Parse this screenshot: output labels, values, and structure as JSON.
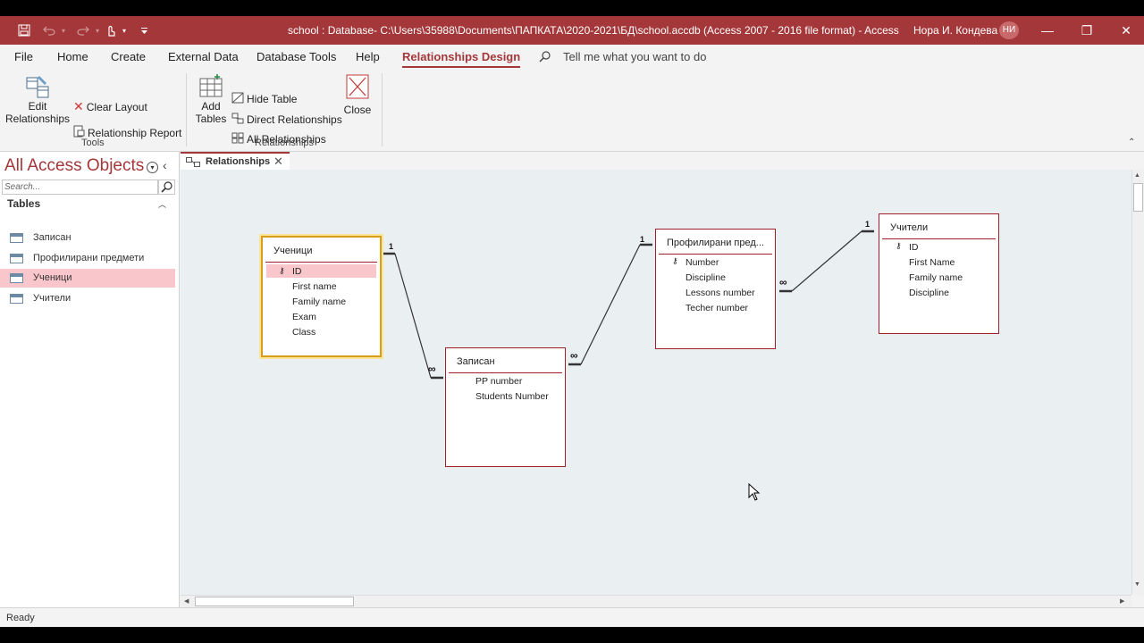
{
  "window": {
    "title": "school : Database- C:\\Users\\35988\\Documents\\ПАПКАТА\\2020-2021\\БД\\school.accdb (Access 2007 - 2016 file format)  -  Access",
    "user": "Нора И. Кондева",
    "initials": "НИ"
  },
  "menu": [
    "File",
    "Home",
    "Create",
    "External Data",
    "Database Tools",
    "Help",
    "Relationships Design"
  ],
  "tell_me": "Tell me what you want to do",
  "ribbon": {
    "edit_relationships": [
      "Edit",
      "Relationships"
    ],
    "clear_layout": "Clear Layout",
    "relationship_report": "Relationship Report",
    "tools_group": "Tools",
    "add_tables": [
      "Add",
      "Tables"
    ],
    "hide_table": "Hide Table",
    "direct_relationships": "Direct Relationships",
    "all_relationships": "All Relationships",
    "close": "Close",
    "relationships_group": "Relationships"
  },
  "nav": {
    "title": "All Access Objects",
    "search_placeholder": "Search...",
    "section": "Tables",
    "items": [
      "Записан",
      "Профилирани предмети",
      "Ученици",
      "Учители"
    ]
  },
  "doc_tab": "Relationships",
  "tables": {
    "uchenici": {
      "title": "Ученици",
      "fields": [
        "ID",
        "First name",
        "Family name",
        "Exam",
        "Class"
      ]
    },
    "zapisan": {
      "title": "Записан",
      "fields": [
        "PP number",
        "Students Number"
      ]
    },
    "profilirani": {
      "title": "Профилирани пред...",
      "fields": [
        "Number",
        "Discipline",
        "Lessons number",
        "Techer number"
      ]
    },
    "uchiteli": {
      "title": "Учители",
      "fields": [
        "ID",
        "First Name",
        "Family name",
        "Discipline"
      ]
    }
  },
  "rel_labels": {
    "one": "1",
    "many": "∞"
  },
  "status": "Ready"
}
